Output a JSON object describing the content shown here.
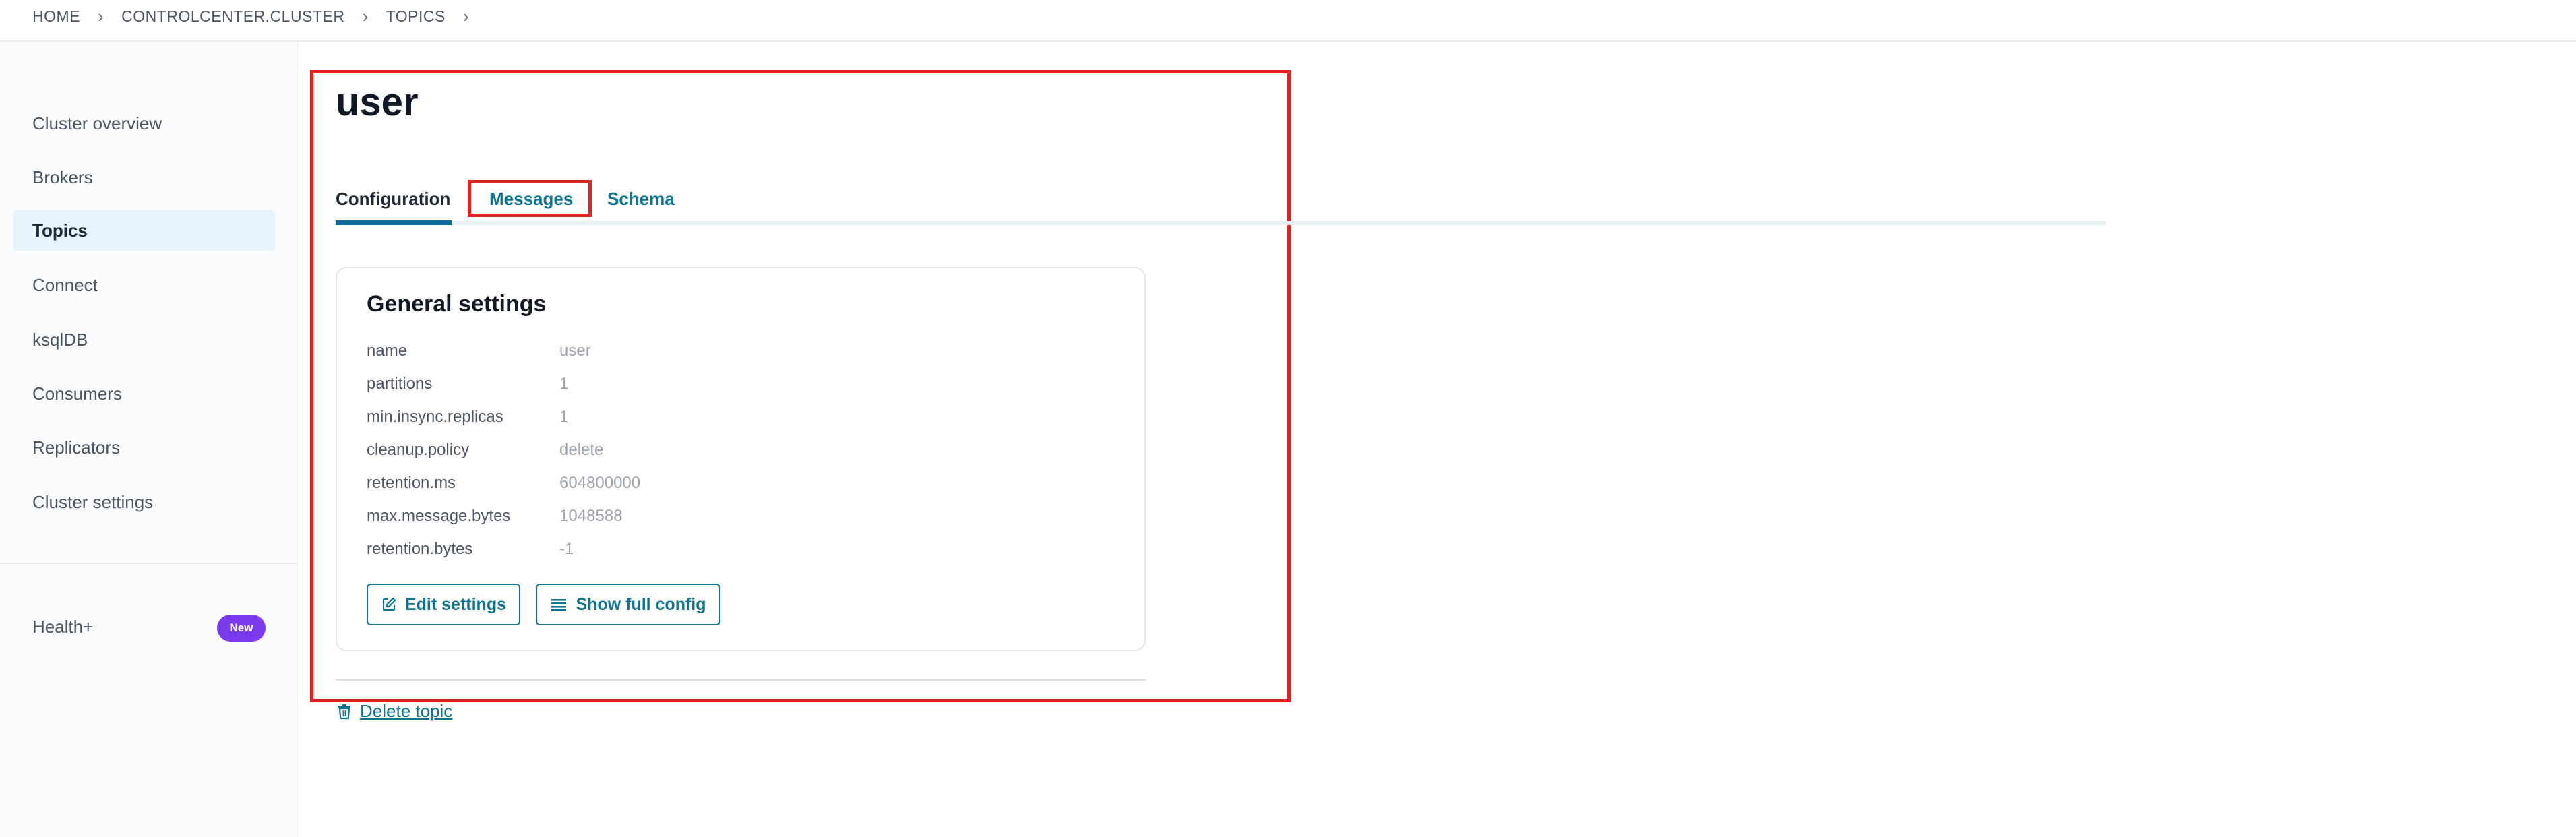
{
  "breadcrumb": [
    "HOME",
    "CONTROLCENTER.CLUSTER",
    "TOPICS"
  ],
  "sidebar": {
    "items": [
      {
        "label": "Cluster overview"
      },
      {
        "label": "Brokers"
      },
      {
        "label": "Topics",
        "active": true
      },
      {
        "label": "Connect"
      },
      {
        "label": "ksqlDB"
      },
      {
        "label": "Consumers"
      },
      {
        "label": "Replicators"
      },
      {
        "label": "Cluster settings"
      }
    ],
    "health_label": "Health+",
    "health_badge": "New"
  },
  "topic": {
    "title": "user",
    "tabs": [
      {
        "label": "Configuration",
        "active": true
      },
      {
        "label": "Messages"
      },
      {
        "label": "Schema"
      }
    ]
  },
  "general_settings": {
    "title": "General settings",
    "rows": [
      {
        "key": "name",
        "value": "user"
      },
      {
        "key": "partitions",
        "value": "1"
      },
      {
        "key": "min.insync.replicas",
        "value": "1"
      },
      {
        "key": "cleanup.policy",
        "value": "delete"
      },
      {
        "key": "retention.ms",
        "value": "604800000"
      },
      {
        "key": "max.message.bytes",
        "value": "1048588"
      },
      {
        "key": "retention.bytes",
        "value": "-1"
      }
    ],
    "edit_button": "Edit settings",
    "config_button": "Show full config"
  },
  "delete_link": "Delete topic",
  "colors": {
    "accent": "#0e7490",
    "highlight": "#e02424",
    "badge": "#7c3aed",
    "active_nav_bg": "#e6f3fa"
  }
}
